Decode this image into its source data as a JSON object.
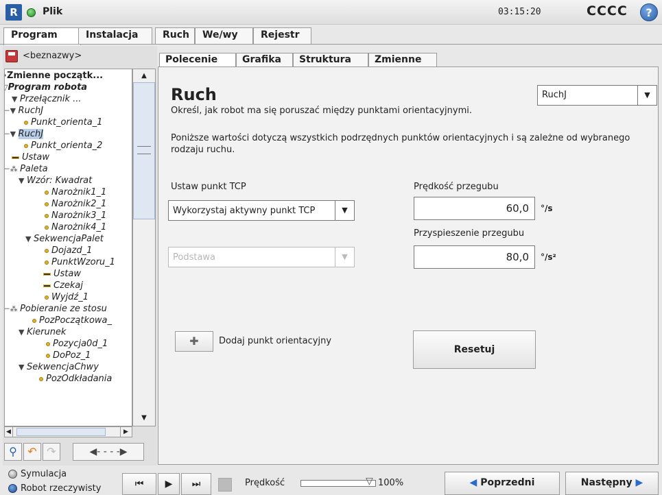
{
  "header": {
    "app_title": "Plik",
    "clock": "03:15:20",
    "robot_name": "CCCC",
    "help": "?"
  },
  "main_tabs": [
    "Program",
    "Instalacja",
    "Ruch",
    "We/wy",
    "Rejestr"
  ],
  "program_name": "<beznazwy>",
  "tree": [
    {
      "label": "Zmienne początk...",
      "bold": true,
      "italic": false
    },
    {
      "label": "Program robota",
      "bold": true,
      "italic": true
    },
    {
      "label": "Przełącznik ...",
      "bold": false
    },
    {
      "label": "RuchJ",
      "bold": false
    },
    {
      "label": "Punkt_orienta_1",
      "bold": false
    },
    {
      "label": "RuchJ",
      "bold": false,
      "selected": true
    },
    {
      "label": "Punkt_orienta_2",
      "bold": false
    },
    {
      "label": "Ustaw",
      "bold": false
    },
    {
      "label": "Paleta",
      "bold": false
    },
    {
      "label": "Wzór: Kwadrat",
      "bold": false
    },
    {
      "label": "Narożnik1_1",
      "bold": false
    },
    {
      "label": "Narożnik2_1",
      "bold": false
    },
    {
      "label": "Narożnik3_1",
      "bold": false
    },
    {
      "label": "Narożnik4_1",
      "bold": false
    },
    {
      "label": "SekwencjaPalet",
      "bold": false
    },
    {
      "label": "Dojazd_1",
      "bold": false
    },
    {
      "label": "PunktWzoru_1",
      "bold": false
    },
    {
      "label": "Ustaw",
      "bold": false
    },
    {
      "label": "Czekaj",
      "bold": false
    },
    {
      "label": "Wyjdź_1",
      "bold": false
    },
    {
      "label": "Pobieranie ze stosu",
      "bold": false
    },
    {
      "label": "PozPoczątkowa_",
      "bold": false
    },
    {
      "label": "Kierunek",
      "bold": false
    },
    {
      "label": "Pozycja0d_1",
      "bold": false
    },
    {
      "label": "DoPoz_1",
      "bold": false
    },
    {
      "label": "SekwencjaChwy",
      "bold": false
    },
    {
      "label": "PozOdkładania",
      "bold": false
    }
  ],
  "sub_tabs": [
    "Polecenie",
    "Grafika",
    "Struktura",
    "Zmienne"
  ],
  "command": {
    "heading": "Ruch",
    "description": "Określ, jak robot ma się poruszać między punktami orientacyjnymi.",
    "note": "Poniższe wartości dotyczą wszystkich podrzędnych punktów orientacyjnych i są zależne od wybranego rodzaju ruchu.",
    "move_type": "RuchJ",
    "tcp_label": "Ustaw punkt TCP",
    "tcp_value": "Wykorzystaj aktywny punkt TCP",
    "base_value": "Podstawa",
    "speed_label": "Prędkość przegubu",
    "speed_value": "60,0",
    "speed_unit": "°/s",
    "acc_label": "Przyspieszenie przegubu",
    "acc_value": "80,0",
    "acc_unit": "°/s²",
    "add_waypoint": "Dodaj punkt orientacyjny",
    "reset": "Resetuj"
  },
  "footer": {
    "simulation": "Symulacja",
    "real_robot": "Robot rzeczywisty",
    "speed_label": "Prędkość",
    "speed_pct": "100%",
    "speed_fraction": 1.0,
    "prev": "Poprzedni",
    "next": "Następny"
  }
}
